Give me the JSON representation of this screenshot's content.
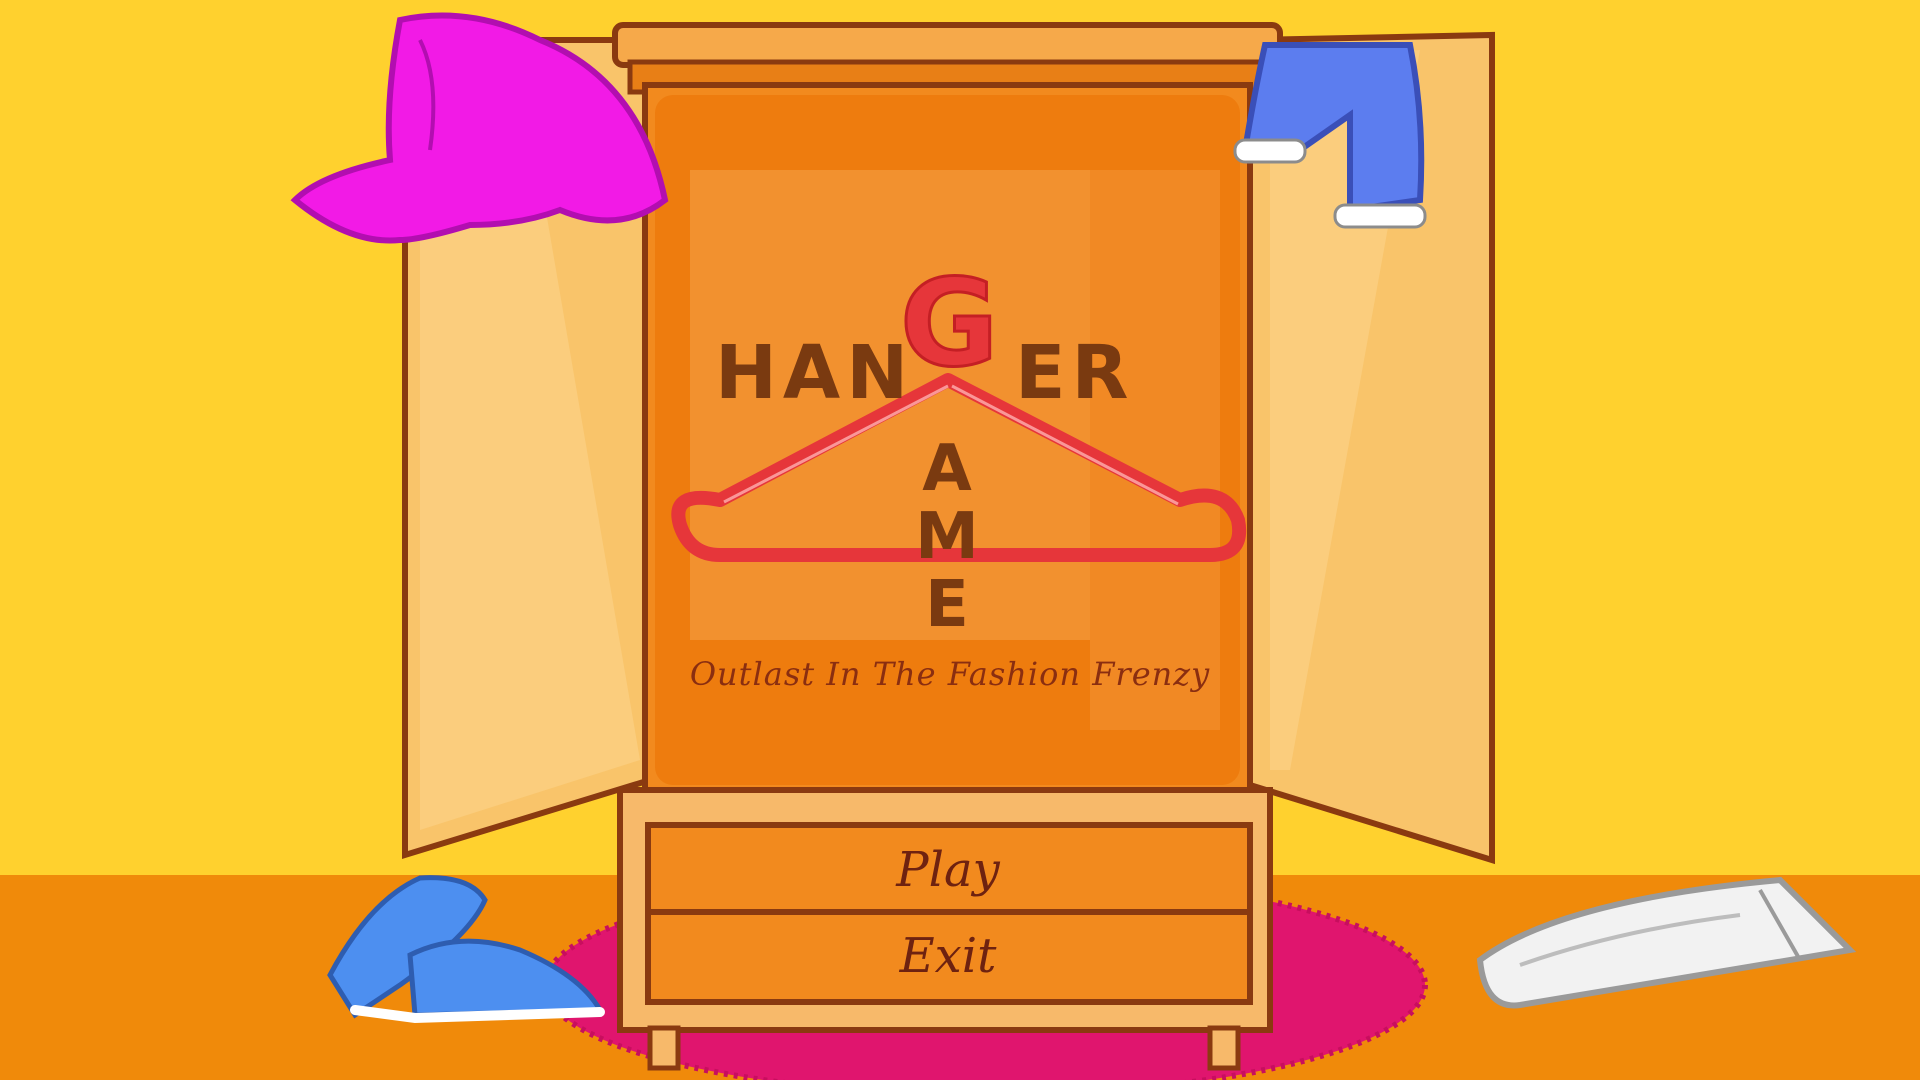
{
  "title": {
    "part1": "HAN",
    "hook_letter": "G",
    "part2": "ER",
    "vertical_letters": [
      "A",
      "M",
      "E"
    ]
  },
  "subtitle": "Outlast In The Fashion Frenzy",
  "menu": {
    "play_label": "Play",
    "exit_label": "Exit"
  },
  "colors": {
    "wall": "#FFD12E",
    "floor": "#F08A0A",
    "wardrobe": "#F28A1E",
    "hanger": "#E6363A",
    "title_text": "#7A3A10",
    "rug": "#E0156E"
  }
}
